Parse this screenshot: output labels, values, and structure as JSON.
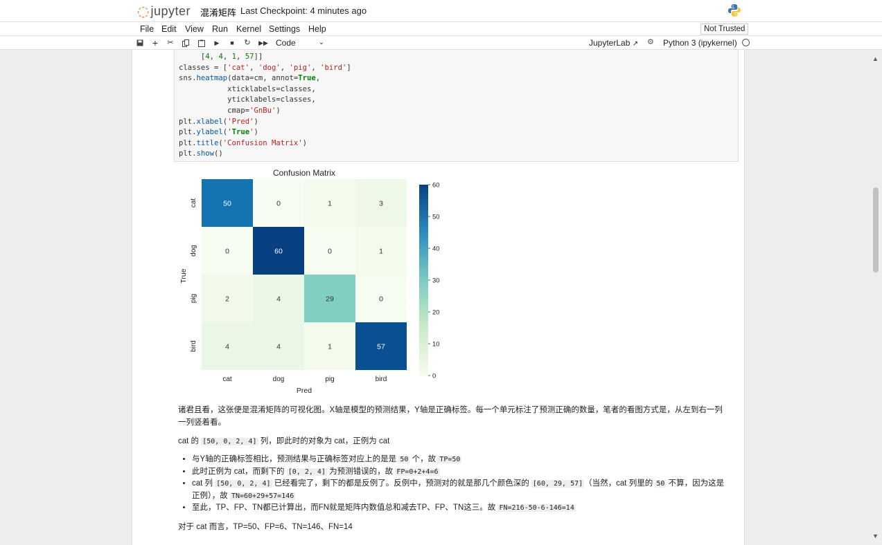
{
  "header": {
    "logo_text": "jupyter",
    "notebook_name": "混淆矩阵",
    "checkpoint": "Last Checkpoint: 4 minutes ago"
  },
  "menu": [
    "File",
    "Edit",
    "View",
    "Run",
    "Kernel",
    "Settings",
    "Help"
  ],
  "trust_label": "Not Trusted",
  "toolbar": {
    "cell_type": "Code",
    "jupyterlab_label": "JupyterLab",
    "kernel": "Python 3 (ipykernel)"
  },
  "code_lines": [
    "     [4, 4, 1, 57]]",
    "classes = ['cat', 'dog', 'pig', 'bird']",
    "sns.heatmap(data=cm, annot=True,",
    "           xticklabels=classes,",
    "           yticklabels=classes,",
    "           cmap='GnBu')",
    "plt.xlabel('Pred')",
    "plt.ylabel('True')",
    "plt.title('Confusion Matrix')",
    "plt.show()"
  ],
  "chart_data": {
    "type": "heatmap",
    "title": "Confusion Matrix",
    "xlabel": "Pred",
    "ylabel": "True",
    "x_categories": [
      "cat",
      "dog",
      "pig",
      "bird"
    ],
    "y_categories": [
      "cat",
      "dog",
      "pig",
      "bird"
    ],
    "values": [
      [
        50,
        0,
        1,
        3
      ],
      [
        0,
        60,
        0,
        1
      ],
      [
        2,
        4,
        29,
        0
      ],
      [
        4,
        4,
        1,
        57
      ]
    ],
    "colormap": "GnBu",
    "colorbar_range": [
      0,
      60
    ],
    "colorbar_ticks": [
      0,
      10,
      20,
      30,
      40,
      50,
      60
    ]
  },
  "markdown": {
    "intro": "诸君且看，这张便是混淆矩阵的可视化图。X轴是模型的预测结果，Y轴是正确标签。每一个单元标注了预测正确的数量，笔者的看图方式是，从左到右一列一列竖着看。",
    "line2_a": "cat 的 ",
    "line2_code": "[50, 0, 2, 4]",
    "line2_b": " 列，即此时的对象为 cat，正例为 cat",
    "b1_a": "与Y轴的正确标签相比，预测结果与正确标签对应上的是是 ",
    "b1_code1": "50",
    "b1_b": " 个，故 ",
    "b1_code2": "TP=50",
    "b2_a": "此时正例为 cat，而剩下的 ",
    "b2_code1": "[0, 2, 4]",
    "b2_b": " 为预测错误的，故 ",
    "b2_code2": "FP=0+2+4=6",
    "b3_a": "cat 列 ",
    "b3_code1": "[50, 0, 2, 4]",
    "b3_b": " 已经看完了，剩下的都是反例了。反例中，预测对的就是那几个颜色深的 ",
    "b3_code2": "[60, 29, 57]",
    "b3_c": "（当然，cat 列里的 ",
    "b3_code3": "50",
    "b3_d": " 不算，因为这是正例），故 ",
    "b3_code4": "TN=60+29+57=146",
    "b4_a": "至此，TP、FP、TN都已计算出，而FN就是矩阵内数值总和减去TP、FP、TN这三。故 ",
    "b4_code": "FN=216-50-6-146=14",
    "summary": "对于 cat 而言，TP=50、FP=6、TN=146、FN=14"
  }
}
